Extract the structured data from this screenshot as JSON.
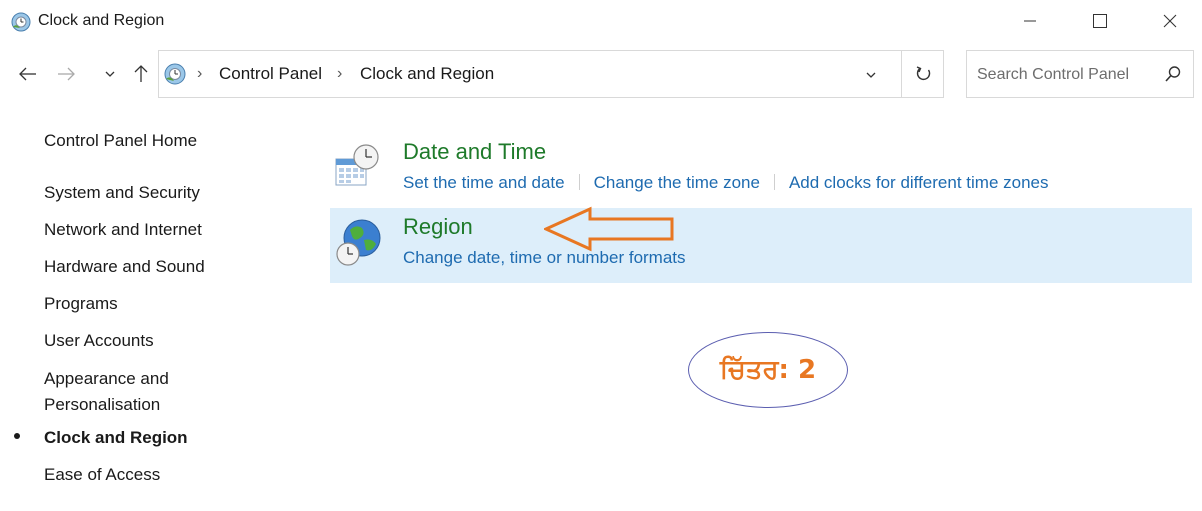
{
  "window": {
    "title": "Clock and Region",
    "icon": "control-panel-clock-icon",
    "controls": {
      "minimize": "minimize-icon",
      "maximize": "maximize-icon",
      "close": "close-icon"
    }
  },
  "navigation": {
    "back": "back-arrow-icon",
    "forward": "forward-arrow-icon",
    "recent": "chevron-down-icon",
    "up": "up-arrow-icon"
  },
  "address": {
    "breadcrumb": [
      "Control Panel",
      "Clock and Region"
    ],
    "separator": "›",
    "refresh_icon": "refresh-icon"
  },
  "search": {
    "placeholder": "Search Control Panel",
    "icon": "search-icon"
  },
  "sidebar": {
    "items": [
      {
        "label": "Control Panel Home"
      },
      {
        "label": "System and Security"
      },
      {
        "label": "Network and Internet"
      },
      {
        "label": "Hardware and Sound"
      },
      {
        "label": "Programs"
      },
      {
        "label": "User Accounts"
      },
      {
        "label": "Appearance and\nPersonalisation"
      },
      {
        "label": "Clock and Region",
        "current": true
      },
      {
        "label": "Ease of Access"
      }
    ]
  },
  "categories": [
    {
      "title": "Date and Time",
      "icon": "date-time-icon",
      "links": [
        "Set the time and date",
        "Change the time zone",
        "Add clocks for different time zones"
      ]
    },
    {
      "title": "Region",
      "icon": "region-globe-icon",
      "links": [
        "Change date, time or number formats"
      ],
      "highlighted": true
    }
  ],
  "annotation": {
    "label": "ਚਿੱਤਰ: 2",
    "arrow_color": "#e87722",
    "label_color": "#e87722",
    "ellipse_color": "#5b5eb0"
  },
  "colors": {
    "category_title": "#1e7a2a",
    "link": "#1e6bb0",
    "highlight_bg": "#ddeefa"
  }
}
